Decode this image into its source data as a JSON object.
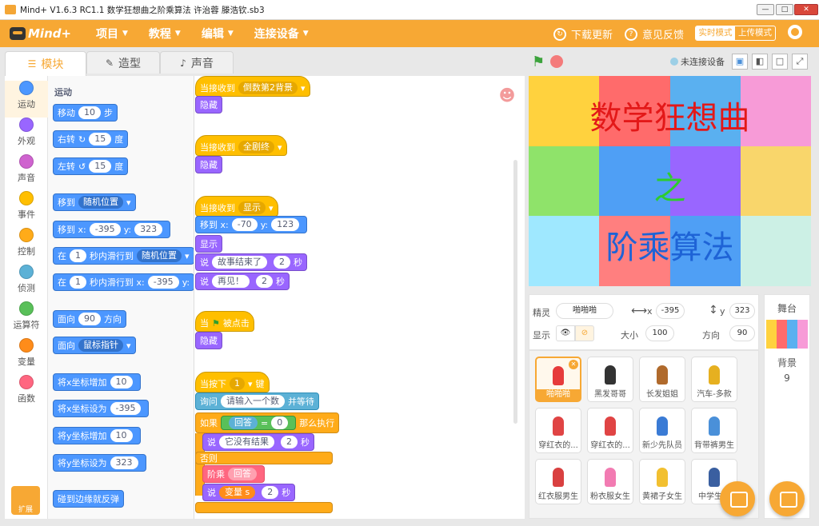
{
  "window": {
    "title": "Mind+ V1.6.3 RC1.1  数学狂想曲之阶乘算法 许治蓉  滕浩钦.sb3"
  },
  "menubar": {
    "logo": "Mind+",
    "items": [
      "项目",
      "教程",
      "编辑",
      "连接设备"
    ],
    "download_update": "下载更新",
    "feedback": "意见反馈",
    "mode_realtime": "实时模式",
    "mode_upload": "上传模式"
  },
  "tabs": [
    "模块",
    "造型",
    "声音"
  ],
  "stage_header": {
    "device_status": "未连接设备"
  },
  "categories": [
    {
      "label": "运动",
      "color": "#4c97ff"
    },
    {
      "label": "外观",
      "color": "#9966ff"
    },
    {
      "label": "声音",
      "color": "#cf63cf"
    },
    {
      "label": "事件",
      "color": "#ffbf00"
    },
    {
      "label": "控制",
      "color": "#ffab19"
    },
    {
      "label": "侦测",
      "color": "#5cb1d6"
    },
    {
      "label": "运算符",
      "color": "#59c059"
    },
    {
      "label": "变量",
      "color": "#ff8c1a"
    },
    {
      "label": "函数",
      "color": "#ff6680"
    }
  ],
  "extension_label": "扩展",
  "palette": {
    "section": "运动",
    "move": {
      "a": "移动",
      "v": "10",
      "b": "步"
    },
    "turn_right": {
      "a": "右转",
      "v": "15",
      "b": "度"
    },
    "turn_left": {
      "a": "左转",
      "v": "15",
      "b": "度"
    },
    "goto": {
      "a": "移到",
      "dd": "随机位置"
    },
    "goto_xy": {
      "a": "移到 x:",
      "x": "-395",
      "yl": "y:",
      "y": "323"
    },
    "glide": {
      "a": "在",
      "v": "1",
      "b": "秒内滑行到",
      "dd": "随机位置"
    },
    "glide_xy": {
      "a": "在",
      "v": "1",
      "b": "秒内滑行到 x:",
      "x": "-395",
      "yl": "y:"
    },
    "point_dir": {
      "a": "面向",
      "v": "90",
      "b": "方向"
    },
    "point_to": {
      "a": "面向",
      "dd": "鼠标指针"
    },
    "change_x": {
      "a": "将x坐标增加",
      "v": "10"
    },
    "set_x": {
      "a": "将x坐标设为",
      "v": "-395"
    },
    "change_y": {
      "a": "将y坐标增加",
      "v": "10"
    },
    "set_y": {
      "a": "将y坐标设为",
      "v": "323"
    },
    "bounce": "碰到边缘就反弹"
  },
  "scripts": {
    "s1": {
      "hat": "当接收到",
      "dd": "倒数第2背景",
      "b": "隐藏"
    },
    "s2": {
      "hat": "当接收到",
      "dd": "全剧终",
      "b": "隐藏"
    },
    "s3": {
      "hat": "当接收到",
      "dd": "显示",
      "move": "移到 x:",
      "x": "-70",
      "yl": "y:",
      "y": "123",
      "show": "显示",
      "say1": "说",
      "say1_text": "故事结束了",
      "say1_sec": "2",
      "sec": "秒",
      "say2": "说",
      "say2_text": "再见！",
      "say2_sec": "2"
    },
    "s4": {
      "hat_a": "当",
      "hat_b": "被点击",
      "b": "隐藏"
    },
    "s5": {
      "hat_a": "当按下",
      "key": "1",
      "hat_b": "键",
      "ask_a": "询问",
      "ask_text": "请输入一个数",
      "ask_b": "并等待",
      "if_a": "如果",
      "answer": "回答",
      "eq": "=",
      "zero": "0",
      "if_b": "那么执行",
      "say_a": "说",
      "say_text": "它没有结果",
      "say_sec": "2",
      "sec": "秒",
      "else": "否则",
      "fact_a": "阶乘",
      "fact_arg": "回答",
      "say2_a": "说",
      "var": "变量 s",
      "say2_sec": "2"
    }
  },
  "stage": {
    "line1": "数学狂想曲",
    "line2": "之",
    "line3": "阶乘算法",
    "colors": [
      [
        "#ffd23e",
        "#ff6b6b",
        "#5ab0f0",
        "#f79bd7"
      ],
      [
        "#8fe36a",
        "#4f9ff5",
        "#9966ff",
        "#f9d66b"
      ],
      [
        "#9fe8ff",
        "#ff7f7f",
        "#4f9ff5",
        "#ccf0e5"
      ]
    ]
  },
  "sprite_info": {
    "sprite_label": "精灵",
    "sprite_name": "啪啪啪",
    "x_label": "x",
    "x": "-395",
    "y_label": "y",
    "y": "323",
    "show_label": "显示",
    "size_label": "大小",
    "size": "100",
    "dir_label": "方向",
    "dir": "90"
  },
  "sprites": [
    {
      "name": "啪啪啪",
      "color": "#e63b3b"
    },
    {
      "name": "黑发哥哥",
      "color": "#333333"
    },
    {
      "name": "长发姐姐",
      "color": "#b06a2c"
    },
    {
      "name": "汽车-多款",
      "color": "#e6b020"
    },
    {
      "name": "穿红衣的...",
      "color": "#e04444"
    },
    {
      "name": "穿红衣的...",
      "color": "#e04444"
    },
    {
      "name": "新少先队员",
      "color": "#3a7bd5"
    },
    {
      "name": "背带裤男生",
      "color": "#4a90d9"
    },
    {
      "name": "红衣服男生",
      "color": "#d94040"
    },
    {
      "name": "粉衣服女生",
      "color": "#f27bb2"
    },
    {
      "name": "黄裙子女生",
      "color": "#f2c030"
    },
    {
      "name": "中学生男",
      "color": "#3a5fa0"
    }
  ],
  "stage_panel": {
    "title": "舞台",
    "backdrop_label": "背景",
    "backdrop_count": "9"
  }
}
